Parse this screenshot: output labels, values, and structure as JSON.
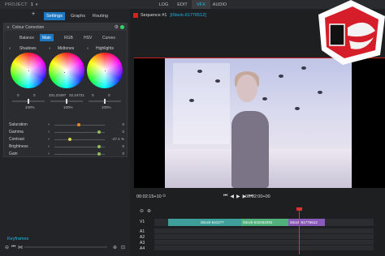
{
  "topbar": {
    "project_label": "PROJECT",
    "project_num": "1",
    "modes": [
      "LOG",
      "EDIT",
      "VFX",
      "AUDIO"
    ],
    "active_mode": "VFX"
  },
  "left_panel": {
    "tabs": [
      "Settings",
      "Graphs",
      "Routing"
    ],
    "active_tab": "Settings",
    "effect_title": "Colour Correction",
    "subtabs": [
      "Balance",
      "Main",
      "RGB",
      "HSV",
      "Curves"
    ],
    "active_subtab": "Main",
    "wheels": [
      {
        "label": "Shadows",
        "value": "0",
        "pct": "100%"
      },
      {
        "label": "Midtones",
        "value": "331.22497",
        "value2": "32.24731",
        "pct": "100%"
      },
      {
        "label": "Highlights",
        "value": "0",
        "pct": "100%"
      }
    ],
    "params": [
      {
        "label": "Saturation",
        "value": "0"
      },
      {
        "label": "Gamma",
        "value": "0"
      },
      {
        "label": "Contrast",
        "value": "-27.1 %"
      },
      {
        "label": "Brightness",
        "value": "0"
      },
      {
        "label": "Gain",
        "value": "0"
      }
    ],
    "keyframes_label": "Keyframes"
  },
  "viewer": {
    "sequence_title": "Sequence #1",
    "clip_title": "[iStock-61776512]",
    "timecode": "00:02:15+10",
    "timecode_right": "00:02:00+00"
  },
  "timeline": {
    "track_labels": [
      "V1",
      "A1",
      "A2",
      "A3",
      "A4"
    ],
    "clips": [
      "iStock-641277",
      "iStock-610262292",
      "iStock-61776512"
    ]
  },
  "colors": {
    "accent": "#1eb9e6",
    "active_tab": "#1d78c4",
    "playhead": "#e03030"
  }
}
